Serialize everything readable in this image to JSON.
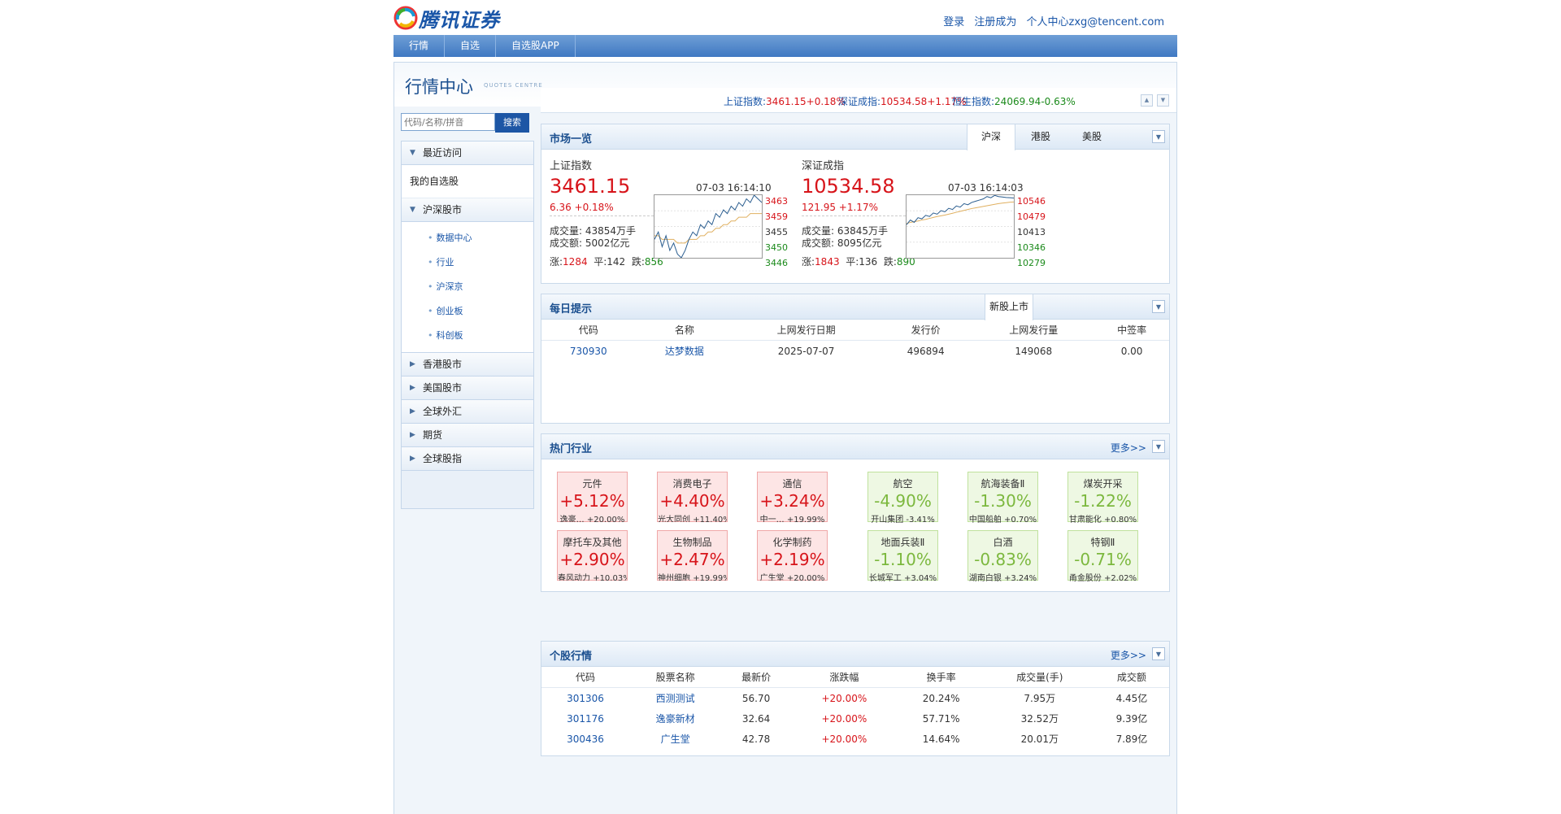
{
  "header": {
    "logo_text": "腾讯证券",
    "links": [
      "登录",
      "注册成为",
      "个人中心zxg@tencent.com"
    ]
  },
  "nav": [
    "行情",
    "自选",
    "自选股APP"
  ],
  "market_center": {
    "title": "行情中心",
    "subtitle": "QUOTES CENTRE"
  },
  "search": {
    "placeholder": "代码/名称/拼音",
    "button": "搜索"
  },
  "sidebar": {
    "recent": "最近访问",
    "watchlist": "我的自选股",
    "shsz": "沪深股市",
    "shsz_items": [
      "数据中心",
      "行业",
      "沪深京",
      "创业板",
      "科创板"
    ],
    "groups": [
      "香港股市",
      "美国股市",
      "全球外汇",
      "期货",
      "全球股指"
    ]
  },
  "index_bar": [
    {
      "name": "上证指数:",
      "value": "3461.15",
      "chg": "+0.18%",
      "color": "red"
    },
    {
      "name": "深证成指:",
      "value": "10534.58",
      "chg": "+1.17%",
      "color": "red"
    },
    {
      "name": "恒生指数:",
      "value": "24069.94",
      "chg": "-0.63%",
      "color": "green"
    }
  ],
  "market_overview": {
    "title": "市场一览",
    "tabs": [
      "沪深",
      "港股",
      "美股"
    ],
    "active_tab": 0,
    "cards": [
      {
        "name": "上证指数",
        "price": "3461.15",
        "change": "6.36 +0.18%",
        "volume": "成交量: 43854万手",
        "amount": "成交额: 5002亿元",
        "up_label": "涨:",
        "up": "1284",
        "flat_label": "平:",
        "flat": "142",
        "down_label": "跌:",
        "down": "856",
        "time": "07-03 16:14:10",
        "axis": [
          "3463",
          "3459",
          "3455",
          "3450",
          "3446"
        ],
        "ylim": [
          3446,
          3463
        ],
        "prices": [
          3451,
          3453,
          3449,
          3452,
          3448,
          3450,
          3447,
          3446,
          3448,
          3451,
          3453,
          3452,
          3455,
          3454,
          3456,
          3455,
          3458,
          3457,
          3459,
          3458,
          3460,
          3459,
          3461,
          3460,
          3462,
          3461,
          3463,
          3462,
          3461
        ],
        "avg": [
          3452,
          3452,
          3451,
          3451,
          3451,
          3451,
          3450,
          3450,
          3450,
          3451,
          3451,
          3451,
          3452,
          3452,
          3453,
          3453,
          3454,
          3454,
          3455,
          3455,
          3456,
          3456,
          3457,
          3457,
          3457,
          3458,
          3458,
          3458,
          3458
        ]
      },
      {
        "name": "深证成指",
        "price": "10534.58",
        "change": "121.95 +1.17%",
        "volume": "成交量: 63845万手",
        "amount": "成交额: 8095亿元",
        "up_label": "涨:",
        "up": "1843",
        "flat_label": "平:",
        "flat": "136",
        "down_label": "跌:",
        "down": "890",
        "time": "07-03 16:14:03",
        "axis": [
          "10546",
          "10479",
          "10413",
          "10346",
          "10279"
        ],
        "ylim": [
          10279,
          10546
        ],
        "prices": [
          10420,
          10440,
          10430,
          10450,
          10445,
          10460,
          10455,
          10470,
          10465,
          10480,
          10475,
          10490,
          10485,
          10500,
          10495,
          10510,
          10505,
          10515,
          10520,
          10525,
          10530,
          10540,
          10535,
          10545,
          10540,
          10538,
          10536,
          10535,
          10534
        ],
        "avg": [
          10425,
          10430,
          10433,
          10436,
          10440,
          10443,
          10447,
          10451,
          10455,
          10458,
          10461,
          10465,
          10469,
          10473,
          10477,
          10481,
          10485,
          10489,
          10492,
          10495,
          10498,
          10501,
          10504,
          10507,
          10510,
          10512,
          10514,
          10516,
          10517
        ]
      }
    ]
  },
  "daily_tips": {
    "title": "每日提示",
    "tab": "新股上市",
    "columns": [
      "代码",
      "名称",
      "上网发行日期",
      "发行价",
      "上网发行量",
      "中签率"
    ],
    "rows": [
      [
        "730930",
        "达梦数据",
        "2025-07-07",
        "496894",
        "149068",
        "0.00"
      ]
    ]
  },
  "hot_sectors": {
    "title": "热门行业",
    "more": "更多>>",
    "up": [
      {
        "name": "元件",
        "pct": "+5.12%",
        "leader": "逸豪…",
        "leader_pct": "+20.00%"
      },
      {
        "name": "消费电子",
        "pct": "+4.40%",
        "leader": "光大同创",
        "leader_pct": "+11.40%"
      },
      {
        "name": "通信",
        "pct": "+3.24%",
        "leader": "中一…",
        "leader_pct": "+19.99%"
      },
      {
        "name": "摩托车及其他",
        "pct": "+2.90%",
        "leader": "春风动力",
        "leader_pct": "+10.03%"
      },
      {
        "name": "生物制品",
        "pct": "+2.47%",
        "leader": "神州细胞",
        "leader_pct": "+19.99%"
      },
      {
        "name": "化学制药",
        "pct": "+2.19%",
        "leader": "广生堂",
        "leader_pct": "+20.00%"
      }
    ],
    "down": [
      {
        "name": "航空",
        "pct": "-4.90%",
        "leader": "开山集团",
        "leader_pct": "-3.41%"
      },
      {
        "name": "航海装备Ⅱ",
        "pct": "-1.30%",
        "leader": "中国船舶",
        "leader_pct": "+0.70%"
      },
      {
        "name": "煤炭开采",
        "pct": "-1.22%",
        "leader": "甘肃能化",
        "leader_pct": "+0.80%"
      },
      {
        "name": "地面兵装Ⅱ",
        "pct": "-1.10%",
        "leader": "长城军工",
        "leader_pct": "+3.04%"
      },
      {
        "name": "白酒",
        "pct": "-0.83%",
        "leader": "湖南白银",
        "leader_pct": "+3.24%"
      },
      {
        "name": "特钢Ⅱ",
        "pct": "-0.71%",
        "leader": "甬金股份",
        "leader_pct": "+2.02%"
      }
    ]
  },
  "stock_quotes": {
    "title": "个股行情",
    "more": "更多>>",
    "columns": [
      "代码",
      "股票名称",
      "最新价",
      "涨跌幅",
      "换手率",
      "成交量(手)",
      "成交额"
    ],
    "rows": [
      [
        "301306",
        "西测测试",
        "56.70",
        "+20.00%",
        "20.24%",
        "7.95万",
        "4.45亿"
      ],
      [
        "301176",
        "逸豪新材",
        "32.64",
        "+20.00%",
        "57.71%",
        "32.52万",
        "9.39亿"
      ],
      [
        "300436",
        "广生堂",
        "42.78",
        "+20.00%",
        "14.64%",
        "20.01万",
        "7.89亿"
      ]
    ]
  },
  "colors": {
    "up": "#d7141a",
    "down": "#1b8a1b",
    "brand": "#1a56a8"
  }
}
